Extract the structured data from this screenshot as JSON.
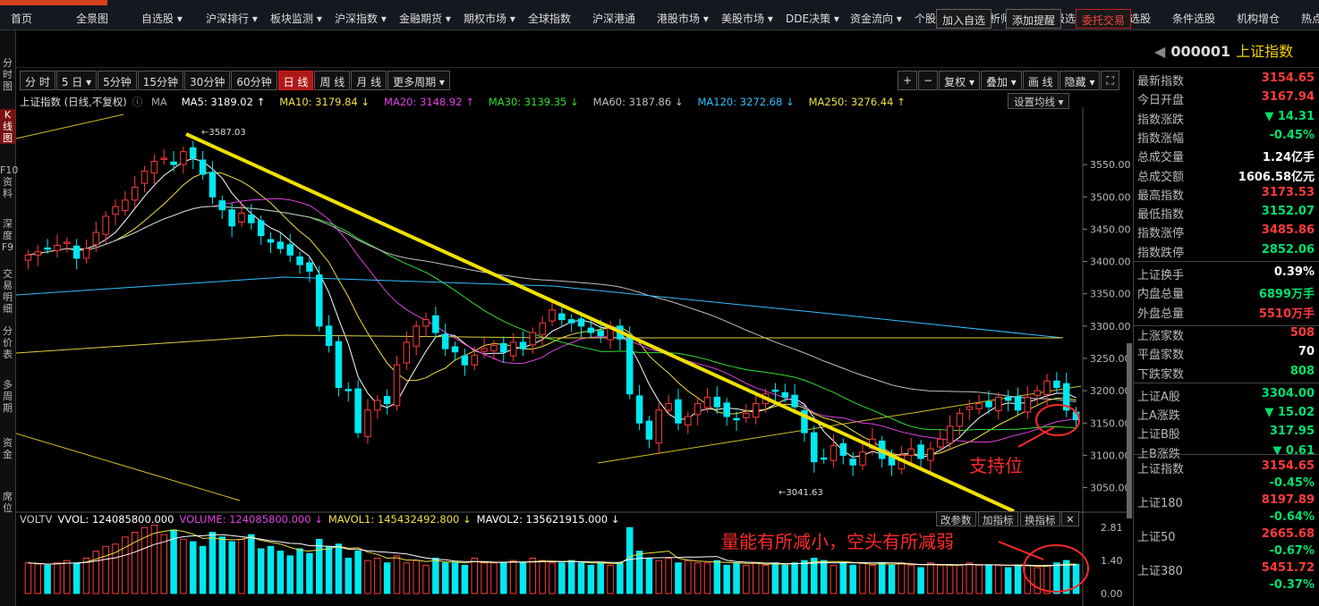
{
  "menu": [
    "首页",
    "全景图",
    "自选股 ▾",
    "沪深排行 ▾",
    "板块监测 ▾",
    "沪深指数 ▾",
    "金融期货 ▾",
    "期权市场 ▾",
    "全球指数",
    "沪深港通",
    "港股市场 ▾",
    "美股市场 ▾",
    "DDE决策 ▾",
    "资金流向 ▾",
    "个股风云 ▾",
    "分析师指数",
    "超级选股",
    "高级选股",
    "条件选股",
    "机构增仓",
    "热点"
  ],
  "left_rail": [
    "分时图",
    "K线图",
    "F10资料",
    "深度F9",
    "交易明细",
    "分价表",
    "多周期",
    "资金",
    "席位"
  ],
  "header_buttons": {
    "add_watch": "加入自选",
    "add_alert": "添加提醒",
    "trade": "委托交易"
  },
  "index": {
    "code": "000001",
    "name": "上证指数"
  },
  "periods": [
    "分 时",
    "5 日 ▾",
    "5分钟",
    "15分钟",
    "30分钟",
    "60分钟",
    "日 线",
    "周 线",
    "月 线",
    "更多周期 ▾"
  ],
  "active_period": "日 线",
  "tools": [
    "+",
    "−",
    "复权 ▾",
    "叠加 ▾",
    "画 线",
    "隐藏 ▾",
    "⛶"
  ],
  "ma_legend": {
    "title": "上证指数 (日线,不复权)",
    "ma_label": "MA",
    "items": [
      {
        "text": "MA5: 3189.02 ↑",
        "color": "#ffffff"
      },
      {
        "text": "MA10: 3179.84 ↓",
        "color": "#f0e040"
      },
      {
        "text": "MA20: 3148.92 ↑",
        "color": "#e040e0"
      },
      {
        "text": "MA30: 3139.35 ↓",
        "color": "#30e030"
      },
      {
        "text": "MA60: 3187.86 ↓",
        "color": "#c0c0c0"
      },
      {
        "text": "MA120: 3272.68 ↓",
        "color": "#30c0ff"
      },
      {
        "text": "MA250: 3276.44 ↑",
        "color": "#f0e040"
      }
    ],
    "set_button": "设置均线 ▾"
  },
  "vol_legend": {
    "items": [
      {
        "text": "VOLTV",
        "color": "#cccccc"
      },
      {
        "text": "VVOL: 124085800.000",
        "color": "#ffffff"
      },
      {
        "text": "VOLUME: 124085800.000 ↓",
        "color": "#e040e0"
      },
      {
        "text": "MAVOL1: 145432492.800 ↓",
        "color": "#f0e040"
      },
      {
        "text": "MAVOL2: 135621915.000 ↓",
        "color": "#ffffff"
      }
    ],
    "buttons": [
      "改参数",
      "加指标",
      "换指标",
      "✕"
    ]
  },
  "chart_data": {
    "type": "candlestick",
    "y_ticks": [
      "3550.00",
      "3500.00",
      "3450.00",
      "3400.00",
      "3350.00",
      "3300.00",
      "3250.00",
      "3200.00",
      "3150.00",
      "3100.00",
      "3050.00"
    ],
    "ylim": [
      3030,
      3600
    ],
    "vol_ticks": [
      "2.81",
      "1.40",
      "0.00"
    ],
    "high_marker": "3587.03",
    "low_marker": "3041.63",
    "closes": [
      3410,
      3415,
      3420,
      3425,
      3430,
      3405,
      3420,
      3445,
      3470,
      3485,
      3495,
      3515,
      3540,
      3555,
      3560,
      3550,
      3570,
      3560,
      3535,
      3500,
      3480,
      3455,
      3475,
      3460,
      3440,
      3430,
      3420,
      3410,
      3395,
      3385,
      3300,
      3270,
      3205,
      3200,
      3135,
      3170,
      3185,
      3180,
      3240,
      3275,
      3300,
      3310,
      3290,
      3265,
      3260,
      3240,
      3255,
      3265,
      3270,
      3260,
      3275,
      3265,
      3290,
      3305,
      3325,
      3310,
      3305,
      3300,
      3290,
      3285,
      3300,
      3280,
      3195,
      3150,
      3125,
      3170,
      3180,
      3150,
      3160,
      3180,
      3190,
      3175,
      3160,
      3155,
      3165,
      3180,
      3195,
      3200,
      3190,
      3175,
      3135,
      3090,
      3095,
      3115,
      3100,
      3085,
      3105,
      3125,
      3095,
      3085,
      3100,
      3110,
      3095,
      3110,
      3125,
      3145,
      3165,
      3175,
      3180,
      3175,
      3190,
      3185,
      3170,
      3190,
      3200,
      3215,
      3205,
      3170,
      3155
    ],
    "volumes": [
      1.3,
      1.25,
      1.2,
      1.3,
      1.4,
      1.3,
      1.5,
      1.8,
      2.0,
      2.1,
      2.4,
      2.6,
      2.8,
      2.9,
      2.5,
      2.7,
      2.3,
      2.2,
      2.0,
      2.6,
      2.4,
      2.2,
      2.3,
      2.5,
      1.9,
      2.0,
      1.8,
      1.6,
      1.9,
      1.7,
      2.3,
      2.0,
      2.1,
      1.5,
      1.8,
      1.4,
      1.5,
      1.3,
      1.6,
      1.3,
      1.4,
      1.2,
      1.5,
      1.3,
      1.3,
      1.2,
      1.5,
      1.3,
      1.3,
      1.3,
      1.4,
      1.3,
      1.5,
      1.4,
      1.3,
      1.3,
      1.4,
      1.3,
      1.2,
      1.3,
      1.2,
      1.3,
      2.8,
      1.8,
      1.5,
      1.4,
      1.5,
      1.3,
      1.4,
      1.3,
      1.3,
      1.4,
      1.2,
      1.3,
      1.2,
      1.3,
      1.2,
      1.3,
      1.2,
      1.3,
      1.4,
      1.5,
      1.4,
      1.2,
      1.3,
      1.2,
      1.3,
      1.2,
      1.3,
      1.2,
      1.3,
      1.2,
      1.1,
      1.3,
      1.2,
      1.2,
      1.2,
      1.3,
      1.2,
      1.2,
      1.2,
      1.1,
      1.2,
      1.2,
      1.1,
      1.2,
      1.3,
      1.4,
      1.24
    ]
  },
  "annotations": {
    "support": "支持位",
    "volume_note": "量能有所减小，空头有所减弱"
  },
  "quote_panel": [
    {
      "label": "最新指数",
      "value": "3154.65",
      "color": "red"
    },
    {
      "label": "今日开盘",
      "value": "3167.94",
      "color": "red"
    },
    {
      "label": "指数涨跌",
      "value": "▼ 14.31",
      "color": "green"
    },
    {
      "label": "指数涨幅",
      "value": "-0.45%",
      "color": "green"
    },
    {
      "label": "总成交量",
      "value": "1.24亿手",
      "color": "white"
    },
    {
      "label": "总成交额",
      "value": "1606.58亿元",
      "color": "white"
    },
    {
      "label": "最高指数",
      "value": "3173.53",
      "color": "red"
    },
    {
      "label": "最低指数",
      "value": "3152.07",
      "color": "green"
    },
    {
      "label": "指数涨停",
      "value": "3485.86",
      "color": "red"
    },
    {
      "label": "指数跌停",
      "value": "2852.06",
      "color": "green"
    },
    {
      "label": "上证换手",
      "value": "0.39%",
      "color": "white"
    },
    {
      "label": "内盘总量",
      "value": "6899万手",
      "color": "green"
    },
    {
      "label": "外盘总量",
      "value": "5510万手",
      "color": "red"
    },
    {
      "label": "上涨家数",
      "value": "508",
      "color": "red"
    },
    {
      "label": "平盘家数",
      "value": "70",
      "color": "white"
    },
    {
      "label": "下跌家数",
      "value": "808",
      "color": "green"
    },
    {
      "label": "上证A股",
      "value": "3304.00",
      "color": "green"
    },
    {
      "label": "上A涨跌",
      "value": "▼ 15.02",
      "color": "green"
    },
    {
      "label": "上证B股",
      "value": "317.95",
      "color": "green"
    },
    {
      "label": "上B涨跌",
      "value": "▼ 0.61",
      "color": "green"
    }
  ],
  "index_list": [
    {
      "name": "上证指数",
      "value": "3154.65",
      "pct": "-0.45%"
    },
    {
      "name": "上证180",
      "value": "8197.89",
      "pct": "-0.64%"
    },
    {
      "name": "上证50",
      "value": "2665.68",
      "pct": "-0.67%"
    },
    {
      "name": "上证380",
      "value": "5451.72",
      "pct": "-0.37%"
    }
  ]
}
